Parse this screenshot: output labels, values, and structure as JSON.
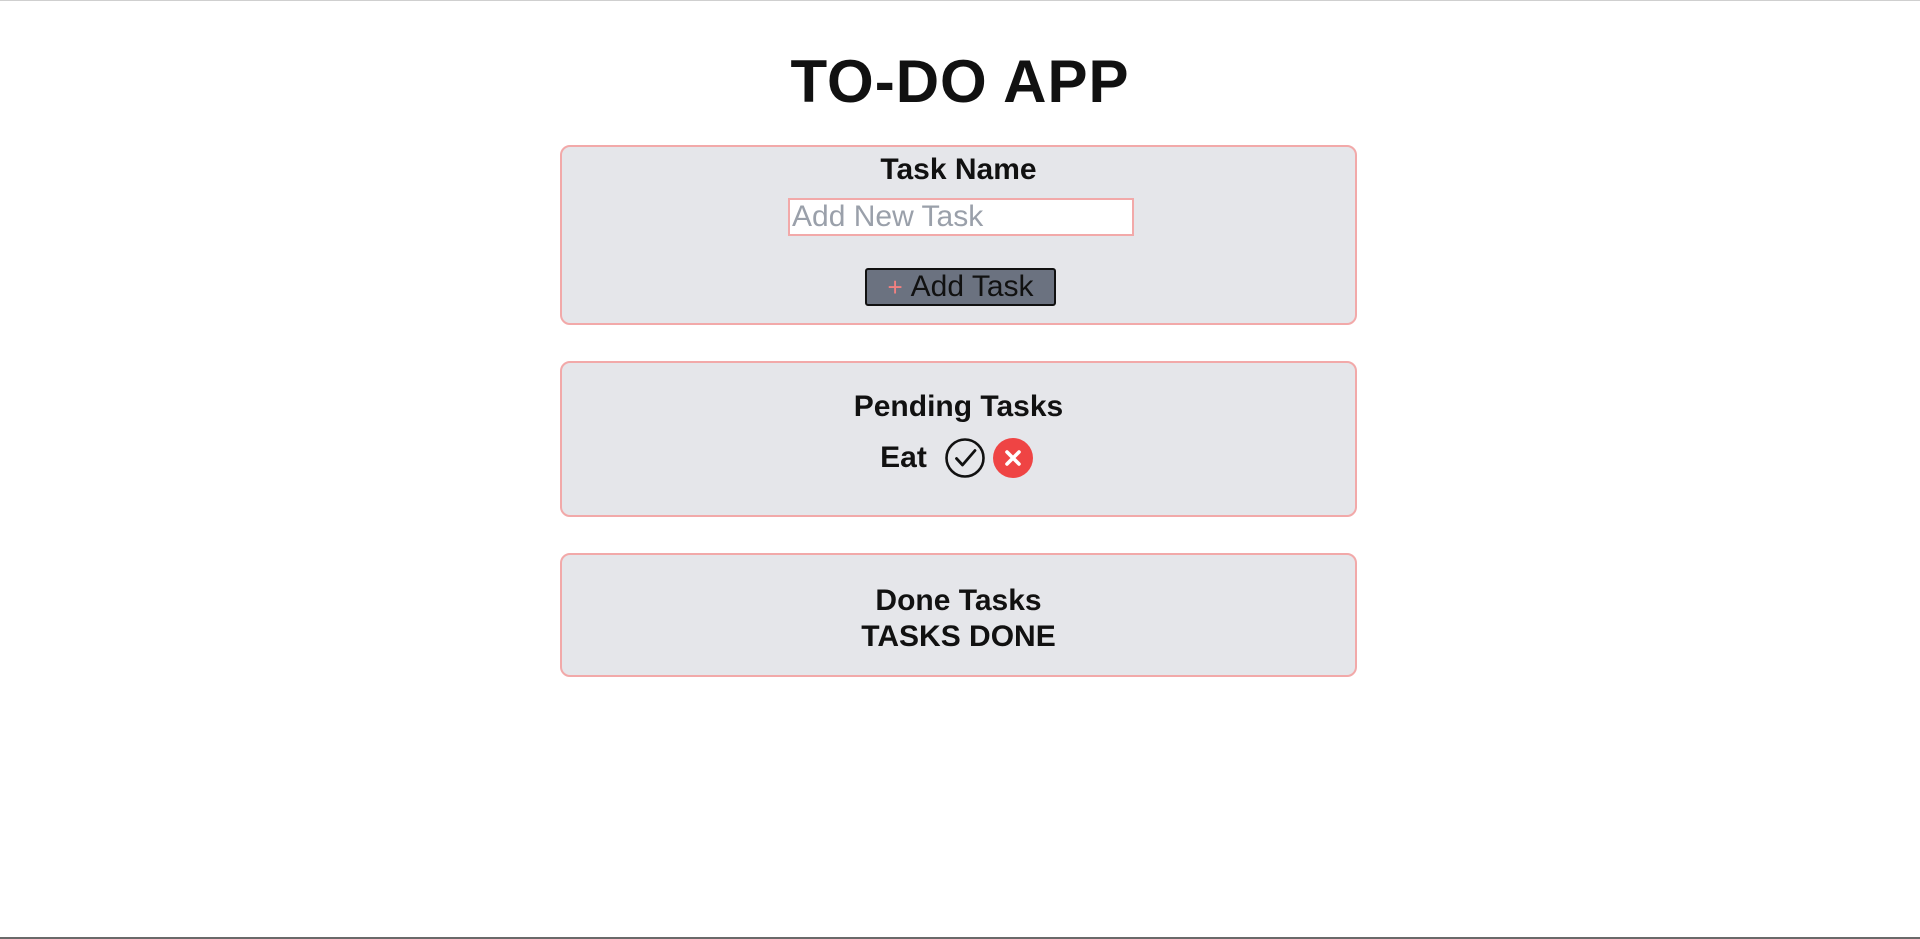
{
  "app": {
    "title": "TO-DO APP"
  },
  "add_card": {
    "label": "Task Name",
    "input_value": "",
    "input_placeholder": "Add New Task",
    "add_button_icon": "+",
    "add_button_label": "Add Task"
  },
  "pending": {
    "title": "Pending Tasks",
    "tasks": [
      {
        "name": "Eat",
        "complete_icon": "check-circle-icon",
        "delete_icon": "x-circle-icon"
      }
    ]
  },
  "done": {
    "title": "Done Tasks",
    "status_text": "TASKS DONE"
  },
  "colors": {
    "card_background": "#e5e6ea",
    "card_border": "#f2a9a9",
    "button_background": "#6b7280",
    "plus_color": "#f08080",
    "delete_red": "#ef4444"
  }
}
